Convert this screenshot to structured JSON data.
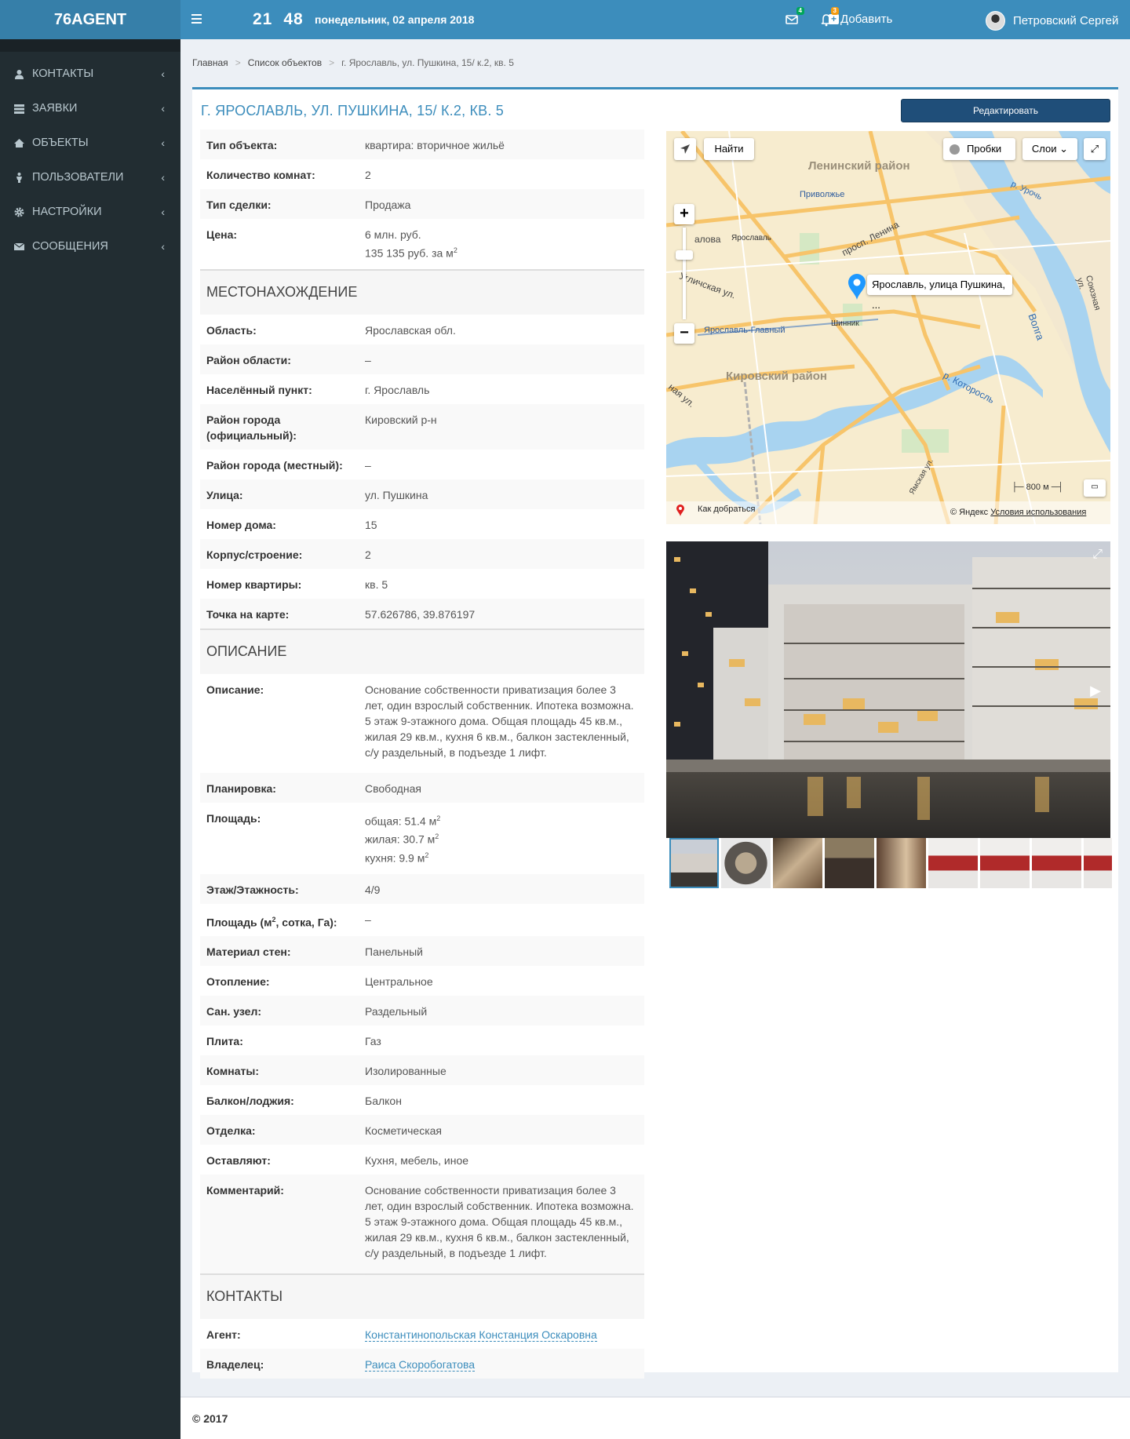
{
  "header": {
    "logo": "76AGENT",
    "clock_hours": "21",
    "clock_minutes": "48",
    "date": "понедельник, 02 апреля 2018",
    "add_label": "Добавить",
    "messages_count": "4",
    "notifications_count": "3",
    "user_name": "Петровский Сергей"
  },
  "sidebar": {
    "items": [
      {
        "label": "КОНТАКТЫ",
        "icon": "user-icon"
      },
      {
        "label": "ЗАЯВКИ",
        "icon": "list-icon"
      },
      {
        "label": "ОБЪЕКТЫ",
        "icon": "home-icon"
      },
      {
        "label": "ПОЛЬЗОВАТЕЛИ",
        "icon": "male-icon"
      },
      {
        "label": "НАСТРОЙКИ",
        "icon": "gear-icon"
      },
      {
        "label": "СООБЩЕНИЯ",
        "icon": "envelope-icon"
      }
    ]
  },
  "breadcrumb": [
    "Главная",
    "Список объектов",
    "г. Ярославль, ул. Пушкина, 15/ к.2, кв. 5"
  ],
  "page": {
    "title": "г. Ярославль, ул. Пушкина, 15/ к.2, кв. 5",
    "edit_label": "Редактировать"
  },
  "details": {
    "type_label": "Тип объекта:",
    "type": "квартира: вторичное жильё",
    "rooms_label": "Количество комнат:",
    "rooms": "2",
    "deal_label": "Тип сделки:",
    "deal": "Продажа",
    "price_label": "Цена:",
    "price": "6 млн. руб.",
    "price_per_m": "135 135 руб. за м",
    "price_unit_sup": "2",
    "section_location": "МЕСТОНАХОЖДЕНИЕ",
    "region_label": "Область:",
    "region": "Ярославская обл.",
    "district_label": "Район области:",
    "district": "–",
    "locality_label": "Населённый пункт:",
    "locality": "г. Ярославль",
    "city_district_label": "Район города (официальный):",
    "city_district": "Кировский р-н",
    "local_district_label": "Район города (местный):",
    "local_district": "–",
    "street_label": "Улица:",
    "street": "ул. Пушкина",
    "house_label": "Номер дома:",
    "house": "15",
    "building_label": "Корпус/строение:",
    "building": "2",
    "flat_label": "Номер квартиры:",
    "flat": "кв. 5",
    "point_label": "Точка на карте:",
    "point": "57.626786, 39.876197",
    "section_description": "ОПИСАНИЕ",
    "desc_label": "Описание:",
    "desc": "Основание собственности приватизация более 3 лет, один взрослый собственник. Ипотека возможна. 5 этаж 9-этажного дома. Общая площадь 45 кв.м., жилая 29 кв.м., кухня 6 кв.м., балкон застекленный, с/у раздельный, в подъезде 1 лифт.",
    "layout_label": "Планировка:",
    "layout": "Свободная",
    "area_label": "Площадь:",
    "area_total": "общая: 51.4 м",
    "area_living": "жилая: 30.7 м",
    "area_kitchen": "кухня: 9.9 м",
    "sq": "2",
    "floor_label": "Этаж/Этажность:",
    "floor": "4/9",
    "land_label_a": "Площадь (м",
    "land_label_b": ", сотка, Га):",
    "land": "–",
    "walls_label": "Материал стен:",
    "walls": "Панельный",
    "heating_label": "Отопление:",
    "heating": "Центральное",
    "bath_label": "Сан. узел:",
    "bath": "Раздельный",
    "stove_label": "Плита:",
    "stove": "Газ",
    "rooms_type_label": "Комнаты:",
    "rooms_type": "Изолированные",
    "balcony_label": "Балкон/лоджия:",
    "balcony": "Балкон",
    "finish_label": "Отделка:",
    "finish": "Косметическая",
    "leave_label": "Оставляют:",
    "leave": "Кухня, мебель, иное",
    "comment_label": "Комментарий:",
    "comment": "Основание собственности приватизация более 3 лет, один взрослый собственник. Ипотека возможна. 5 этаж 9-этажного дома. Общая площадь 45 кв.м., жилая 29 кв.м., кухня 6 кв.м., балкон застекленный, с/у раздельный, в подъезде 1 лифт.",
    "section_contacts": "КОНТАКТЫ",
    "agent_label": "Агент:",
    "agent": "Константинопольская Констанция Оскаровна",
    "owner_label": "Владелец:",
    "owner": "Раиса Скоробогатова"
  },
  "map": {
    "find_label": "Найти",
    "traffic_label": "Пробки",
    "layers_label": "Слои",
    "balloon": "Ярославль, улица Пушкина, ...",
    "district_leninsky": "Ленинский район",
    "district_kirovsky": "Кировский район",
    "place_privolzhye": "Приволжье",
    "place_yaroslavl": "Ярославль",
    "place_yaroslavl_main": "Ярославль-Главный",
    "place_shinnik": "Шинник",
    "street_lenina": "просп. Ленина",
    "street_uglichskaya": "Угличская ул.",
    "street_kotorosl": "р. Которосль",
    "street_volga": "Волга",
    "street_urouch": "р. Урочь",
    "street_soyuznaya": "Союзная ул.",
    "street_yamskaya": "Ямская ул.",
    "street_frag1": "алова",
    "street_frag2": "ная ул.",
    "scale": "800 м",
    "route_label": "Как добраться",
    "copyright": "© Яндекс",
    "terms": "Условия использования",
    "accent": "#1e98ff"
  },
  "gallery": {
    "thumb_count": 9,
    "selected": 1
  },
  "footer": {
    "copyright": "© 2017"
  },
  "colors": {
    "brand": "#3c8dbc",
    "sidebar": "#222d32",
    "edit_button": "#1f4e79"
  }
}
